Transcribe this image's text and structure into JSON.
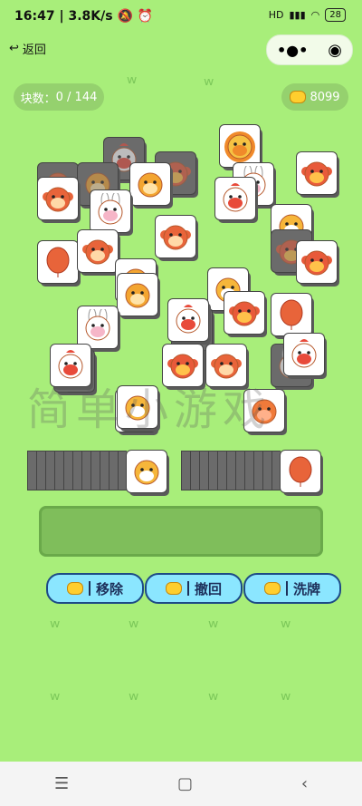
{
  "status_bar": {
    "time": "16:47",
    "speed": "3.8K/s",
    "battery": "28"
  },
  "header": {
    "back_label": "返回"
  },
  "hud": {
    "blocks_label": "块数：",
    "blocks_count": "0 / 144",
    "coins": "8099"
  },
  "actions": [
    {
      "label": "移除",
      "name": "remove-button"
    },
    {
      "label": "撤回",
      "name": "undo-button"
    },
    {
      "label": "洗牌",
      "name": "shuffle-button"
    }
  ],
  "watermark": "简单小游戏",
  "colors": {
    "background": "#a8ee7a",
    "tile_dim": "#6b6b6b",
    "button": "#8be6ff",
    "button_border": "#1d4a86"
  },
  "tiles": [
    {
      "animal": "monkey",
      "dim": true
    },
    {
      "animal": "chicken",
      "dim": true
    },
    {
      "animal": "dog",
      "dim": true
    },
    {
      "animal": "cow",
      "dim": true
    },
    {
      "animal": "lion",
      "dim": false
    },
    {
      "animal": "monkey",
      "dim": false
    },
    {
      "animal": "dog",
      "dim": false
    },
    {
      "animal": "rabbit",
      "dim": false
    },
    {
      "animal": "cow",
      "dim": false
    },
    {
      "animal": "rabbit",
      "dim": false
    },
    {
      "animal": "chicken",
      "dim": false
    },
    {
      "animal": "monkey",
      "dim": false
    },
    {
      "animal": "tiger",
      "dim": false
    },
    {
      "animal": "cow",
      "dim": true
    },
    {
      "animal": "balloon",
      "dim": false
    },
    {
      "animal": "monkey",
      "dim": false
    },
    {
      "animal": "dog",
      "dim": false
    },
    {
      "animal": "dog",
      "dim": false
    },
    {
      "animal": "tiger",
      "dim": false
    },
    {
      "animal": "cow",
      "dim": false
    },
    {
      "animal": "balloon",
      "dim": false
    },
    {
      "animal": "rabbit",
      "dim": false
    },
    {
      "animal": "chicken",
      "dim": true
    },
    {
      "animal": "chicken",
      "dim": false
    },
    {
      "animal": "cow",
      "dim": false
    },
    {
      "animal": "monkey",
      "dim": false
    },
    {
      "animal": "cow",
      "dim": false
    },
    {
      "animal": "rabbit",
      "dim": true
    },
    {
      "animal": "chicken",
      "dim": false
    },
    {
      "animal": "cow",
      "dim": true
    },
    {
      "animal": "chicken",
      "dim": false
    },
    {
      "animal": "lion",
      "dim": false
    },
    {
      "animal": "pig",
      "dim": false
    },
    {
      "animal": "tiger",
      "dim": false
    }
  ],
  "left_slot": {
    "animal": "tiger"
  },
  "right_slot": {
    "animal": "balloon"
  }
}
